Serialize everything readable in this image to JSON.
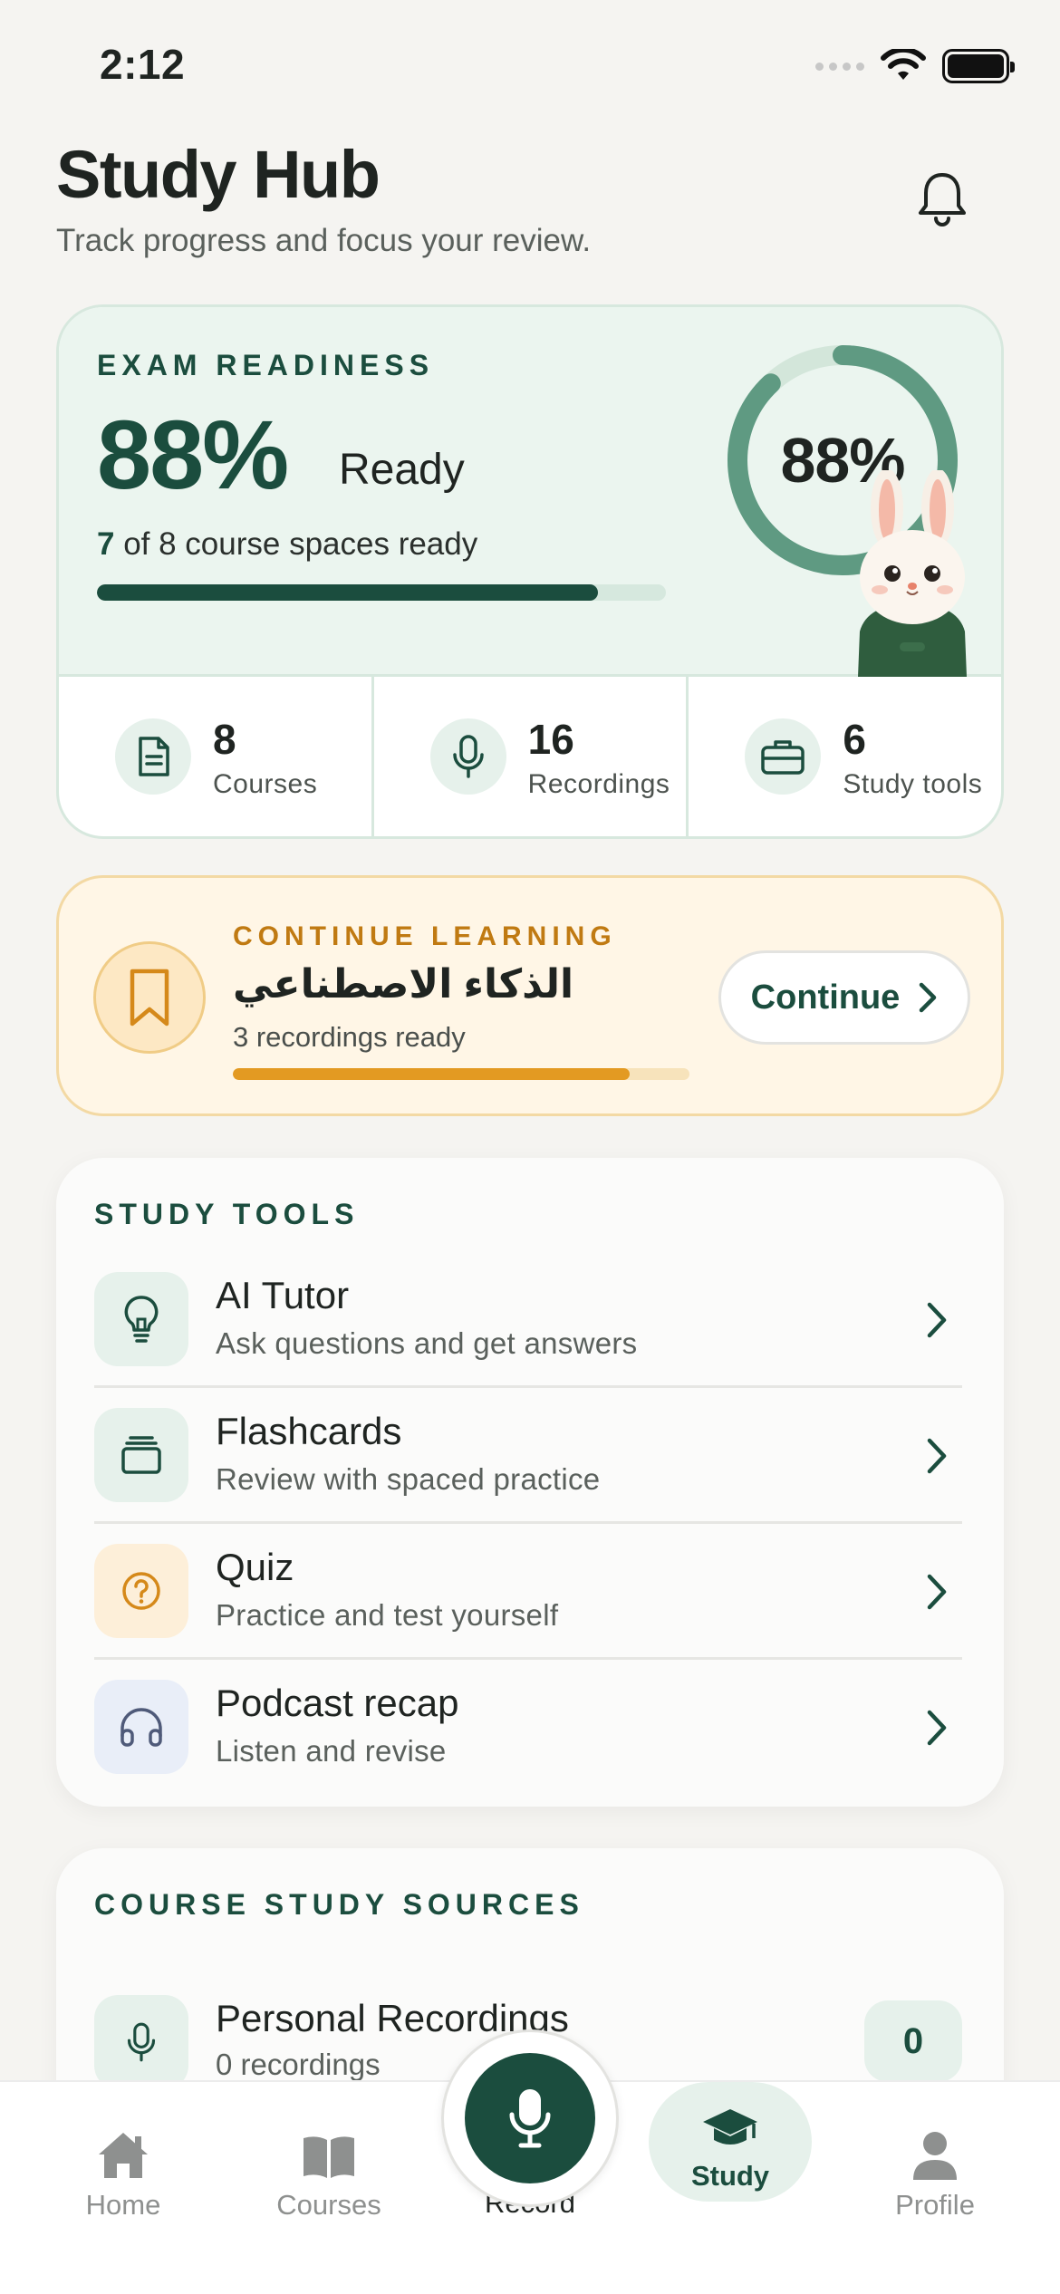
{
  "status_bar": {
    "time": "2:12"
  },
  "header": {
    "title": "Study Hub",
    "subtitle": "Track progress and focus your review."
  },
  "readiness": {
    "eyebrow": "EXAM READINESS",
    "percent_text": "88%",
    "ready_word": "Ready",
    "ready_count": "7",
    "ready_text": " of 8 course spaces ready",
    "ring_label": "88%",
    "progress": 0.88,
    "stats": [
      {
        "value": "8",
        "label": "Courses",
        "icon": "document-icon"
      },
      {
        "value": "16",
        "label": "Recordings",
        "icon": "microphone-icon"
      },
      {
        "value": "6",
        "label": "Study tools",
        "icon": "briefcase-icon"
      }
    ]
  },
  "continue_learning": {
    "eyebrow": "CONTINUE LEARNING",
    "title": "الذكاء الاصطناعي",
    "subtitle": "3 recordings ready",
    "button_label": "Continue",
    "progress": 0.87
  },
  "study_tools": {
    "eyebrow": "STUDY TOOLS",
    "items": [
      {
        "title": "AI Tutor",
        "subtitle": "Ask questions and get answers",
        "icon": "lightbulb-icon"
      },
      {
        "title": "Flashcards",
        "subtitle": "Review with spaced practice",
        "icon": "cards-stack-icon"
      },
      {
        "title": "Quiz",
        "subtitle": "Practice and test yourself",
        "icon": "question-circle-icon"
      },
      {
        "title": "Podcast recap",
        "subtitle": "Listen and revise",
        "icon": "headphones-icon"
      }
    ]
  },
  "course_sources": {
    "eyebrow": "COURSE STUDY SOURCES",
    "items": [
      {
        "title": "Personal Recordings",
        "subtitle": "0 recordings",
        "count": "0",
        "icon": "microphone-icon"
      }
    ]
  },
  "tab_bar": {
    "tabs": [
      {
        "label": "Home",
        "icon": "house-icon"
      },
      {
        "label": "Courses",
        "icon": "open-book-icon"
      },
      {
        "label": "Record",
        "icon": "microphone-icon"
      },
      {
        "label": "Study",
        "icon": "graduation-cap-icon"
      },
      {
        "label": "Profile",
        "icon": "person-icon"
      }
    ],
    "active": "Study"
  },
  "colors": {
    "brand_green": "#1b4d3e",
    "ring_green": "#5f9a82",
    "accent_orange": "#e39a22",
    "background": "#f5f4f1"
  }
}
